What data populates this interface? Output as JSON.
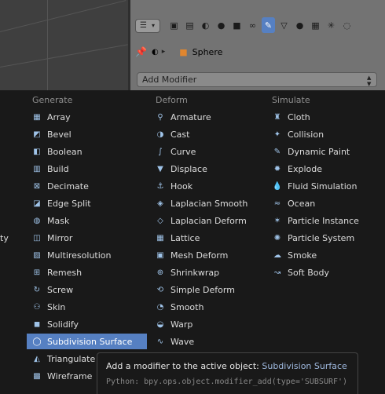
{
  "header": {
    "object_name": "Sphere",
    "add_modifier_label": "Add Modifier",
    "dropdown_arrow": "▲▼"
  },
  "tabs": [
    {
      "icon": "render-icon",
      "glyph": "▣"
    },
    {
      "icon": "render-layers-icon",
      "glyph": "▤"
    },
    {
      "icon": "scene-icon",
      "glyph": "◐"
    },
    {
      "icon": "world-icon",
      "glyph": "●"
    },
    {
      "icon": "object-icon",
      "glyph": "■"
    },
    {
      "icon": "constraints-icon",
      "glyph": "∞"
    },
    {
      "icon": "modifiers-wrench-icon",
      "glyph": "✎"
    },
    {
      "icon": "data-icon",
      "glyph": "▽"
    },
    {
      "icon": "material-icon",
      "glyph": "●"
    },
    {
      "icon": "texture-icon",
      "glyph": "▦"
    },
    {
      "icon": "particles-icon",
      "glyph": "✳"
    },
    {
      "icon": "physics-icon",
      "glyph": "◌"
    }
  ],
  "menu": {
    "generate": {
      "heading": "Generate",
      "items": [
        {
          "label": "Array",
          "icon": "array-icon",
          "glyph": "▦"
        },
        {
          "label": "Bevel",
          "icon": "bevel-icon",
          "glyph": "◩"
        },
        {
          "label": "Boolean",
          "icon": "boolean-icon",
          "glyph": "◧"
        },
        {
          "label": "Build",
          "icon": "build-icon",
          "glyph": "▥"
        },
        {
          "label": "Decimate",
          "icon": "decimate-icon",
          "glyph": "⊠"
        },
        {
          "label": "Edge Split",
          "icon": "edge-split-icon",
          "glyph": "◪"
        },
        {
          "label": "Mask",
          "icon": "mask-icon",
          "glyph": "◍"
        },
        {
          "label": "Mirror",
          "icon": "mirror-icon",
          "glyph": "◫"
        },
        {
          "label": "Multiresolution",
          "icon": "multires-icon",
          "glyph": "▨"
        },
        {
          "label": "Remesh",
          "icon": "remesh-icon",
          "glyph": "⊞"
        },
        {
          "label": "Screw",
          "icon": "screw-icon",
          "glyph": "↻"
        },
        {
          "label": "Skin",
          "icon": "skin-icon",
          "glyph": "⚇"
        },
        {
          "label": "Solidify",
          "icon": "solidify-icon",
          "glyph": "◼"
        },
        {
          "label": "Subdivision Surface",
          "icon": "subsurf-icon",
          "glyph": "◯"
        },
        {
          "label": "Triangulate",
          "icon": "triangulate-icon",
          "glyph": "◭"
        },
        {
          "label": "Wireframe",
          "icon": "wireframe-icon",
          "glyph": "▩"
        }
      ]
    },
    "deform": {
      "heading": "Deform",
      "items": [
        {
          "label": "Armature",
          "icon": "armature-icon",
          "glyph": "⚲"
        },
        {
          "label": "Cast",
          "icon": "cast-icon",
          "glyph": "◑"
        },
        {
          "label": "Curve",
          "icon": "curve-icon",
          "glyph": "∫"
        },
        {
          "label": "Displace",
          "icon": "displace-icon",
          "glyph": "▼"
        },
        {
          "label": "Hook",
          "icon": "hook-icon",
          "glyph": "⚓"
        },
        {
          "label": "Laplacian Smooth",
          "icon": "laplacian-smooth-icon",
          "glyph": "◈"
        },
        {
          "label": "Laplacian Deform",
          "icon": "laplacian-deform-icon",
          "glyph": "◇"
        },
        {
          "label": "Lattice",
          "icon": "lattice-icon",
          "glyph": "▦"
        },
        {
          "label": "Mesh Deform",
          "icon": "mesh-deform-icon",
          "glyph": "▣"
        },
        {
          "label": "Shrinkwrap",
          "icon": "shrinkwrap-icon",
          "glyph": "⊕"
        },
        {
          "label": "Simple Deform",
          "icon": "simple-deform-icon",
          "glyph": "⟲"
        },
        {
          "label": "Smooth",
          "icon": "smooth-icon",
          "glyph": "◔"
        },
        {
          "label": "Warp",
          "icon": "warp-icon",
          "glyph": "◒"
        },
        {
          "label": "Wave",
          "icon": "wave-icon",
          "glyph": "∿"
        }
      ]
    },
    "simulate": {
      "heading": "Simulate",
      "items": [
        {
          "label": "Cloth",
          "icon": "cloth-icon",
          "glyph": "♜"
        },
        {
          "label": "Collision",
          "icon": "collision-icon",
          "glyph": "✦"
        },
        {
          "label": "Dynamic Paint",
          "icon": "dynamic-paint-icon",
          "glyph": "✎"
        },
        {
          "label": "Explode",
          "icon": "explode-icon",
          "glyph": "✹"
        },
        {
          "label": "Fluid Simulation",
          "icon": "fluid-icon",
          "glyph": "💧"
        },
        {
          "label": "Ocean",
          "icon": "ocean-icon",
          "glyph": "≈"
        },
        {
          "label": "Particle Instance",
          "icon": "particle-instance-icon",
          "glyph": "✶"
        },
        {
          "label": "Particle System",
          "icon": "particle-system-icon",
          "glyph": "✺"
        },
        {
          "label": "Smoke",
          "icon": "smoke-icon",
          "glyph": "☁"
        },
        {
          "label": "Soft Body",
          "icon": "soft-body-icon",
          "glyph": "↝"
        }
      ]
    }
  },
  "left_edge_text": "ty",
  "tooltip": {
    "prefix": "Add a modifier to the active object:",
    "value": "Subdivision Surface",
    "python": "Python: bpy.ops.object.modifier_add(type='SUBSURF')"
  },
  "colors": {
    "highlight": "#5680c2",
    "menu_bg": "#191919",
    "panel_bg": "#737373"
  }
}
